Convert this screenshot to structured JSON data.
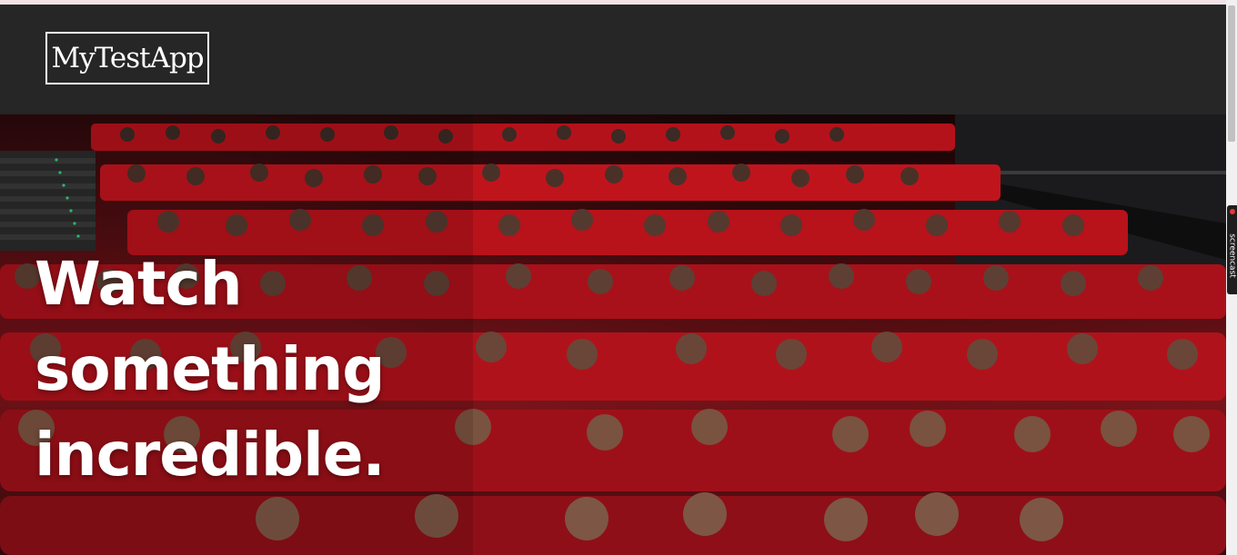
{
  "nav": {
    "brand": "MyTestApp"
  },
  "hero": {
    "title_lines": [
      "Watch",
      "something",
      "incredible."
    ],
    "image_description": "cinema audience seated in red seats"
  },
  "extension": {
    "label": "screencast"
  },
  "colors": {
    "navbar": "#262626",
    "seat_red": "#a3151c",
    "text": "#ffffff"
  }
}
